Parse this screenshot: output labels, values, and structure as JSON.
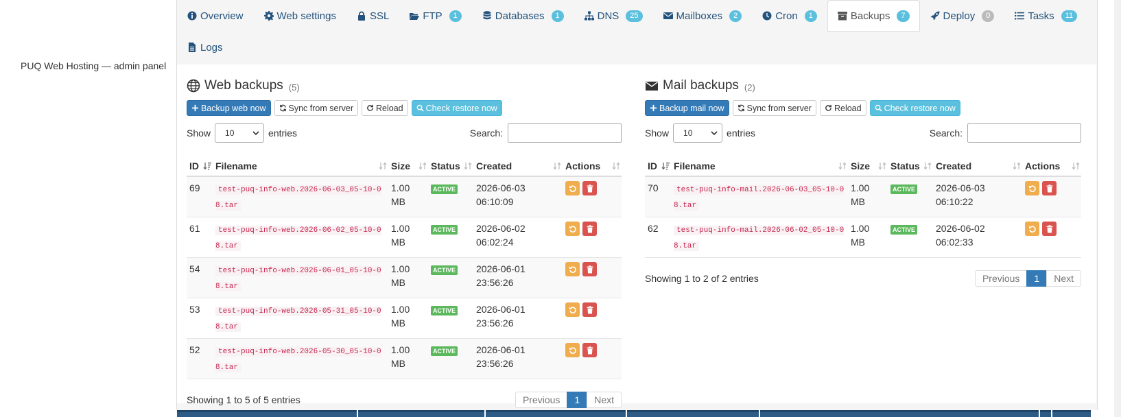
{
  "app": {
    "side_label": "PUQ Web Hosting — admin panel"
  },
  "tabs": [
    {
      "label": "Overview",
      "icon": "info-circle-icon",
      "badge": ""
    },
    {
      "label": "Web settings",
      "icon": "gear-icon",
      "badge": ""
    },
    {
      "label": "SSL",
      "icon": "lock-icon",
      "badge": ""
    },
    {
      "label": "FTP",
      "icon": "folder-open-icon",
      "badge": "1"
    },
    {
      "label": "Databases",
      "icon": "database-icon",
      "badge": "1"
    },
    {
      "label": "DNS",
      "icon": "sitemap-icon",
      "badge": "25"
    },
    {
      "label": "Mailboxes",
      "icon": "envelope-icon",
      "badge": "2"
    },
    {
      "label": "Cron",
      "icon": "clock-icon",
      "badge": "1"
    },
    {
      "label": "Backups",
      "icon": "archive-icon",
      "badge": "7",
      "active": true
    },
    {
      "label": "Deploy",
      "icon": "rocket-icon",
      "badge": "0"
    },
    {
      "label": "Tasks",
      "icon": "list-icon",
      "badge": "11"
    },
    {
      "label": "Logs",
      "icon": "file-icon",
      "badge": ""
    }
  ],
  "web": {
    "title": "Web backups",
    "count": "(5)",
    "buttons": {
      "backup_now": "Backup web now",
      "sync": "Sync from server",
      "reload": "Reload",
      "check_restore": "Check restore now"
    },
    "show_label": "Show",
    "entries_label": "entries",
    "page_length": "10",
    "search_label": "Search:",
    "search_value": "",
    "columns": [
      "ID",
      "Filename",
      "Size",
      "Status",
      "Created",
      "Actions"
    ],
    "rows": [
      {
        "id": "69",
        "filename": "test-puq-info-web.2026-06-03_05-10-08.tar",
        "size": "1.00 MB",
        "status": "ACTIVE",
        "created": "2026-06-03 06:10:09"
      },
      {
        "id": "61",
        "filename": "test-puq-info-web.2026-06-02_05-10-08.tar",
        "size": "1.00 MB",
        "status": "ACTIVE",
        "created": "2026-06-02 06:02:24"
      },
      {
        "id": "54",
        "filename": "test-puq-info-web.2026-06-01_05-10-08.tar",
        "size": "1.00 MB",
        "status": "ACTIVE",
        "created": "2026-06-01 23:56:26"
      },
      {
        "id": "53",
        "filename": "test-puq-info-web.2026-05-31_05-10-08.tar",
        "size": "1.00 MB",
        "status": "ACTIVE",
        "created": "2026-06-01 23:56:26"
      },
      {
        "id": "52",
        "filename": "test-puq-info-web.2026-05-30_05-10-08.tar",
        "size": "1.00 MB",
        "status": "ACTIVE",
        "created": "2026-06-01 23:56:26"
      }
    ],
    "info": "Showing 1 to 5 of 5 entries",
    "pager": {
      "prev": "Previous",
      "page": "1",
      "next": "Next"
    }
  },
  "mail": {
    "title": "Mail backups",
    "count": "(2)",
    "buttons": {
      "backup_now": "Backup mail now",
      "sync": "Sync from server",
      "reload": "Reload",
      "check_restore": "Check restore now"
    },
    "show_label": "Show",
    "entries_label": "entries",
    "page_length": "10",
    "search_label": "Search:",
    "search_value": "",
    "columns": [
      "ID",
      "Filename",
      "Size",
      "Status",
      "Created",
      "Actions"
    ],
    "rows": [
      {
        "id": "70",
        "filename": "test-puq-info-mail.2026-06-03_05-10-08.tar",
        "size": "1.00 MB",
        "status": "ACTIVE",
        "created": "2026-06-03 06:10:22"
      },
      {
        "id": "62",
        "filename": "test-puq-info-mail.2026-06-02_05-10-08.tar",
        "size": "1.00 MB",
        "status": "ACTIVE",
        "created": "2026-06-02 06:02:33"
      }
    ],
    "info": "Showing 1 to 2 of 2 entries",
    "pager": {
      "prev": "Previous",
      "page": "1",
      "next": "Next"
    }
  },
  "colors": {
    "primary": "#337ab7",
    "info": "#5bc0de",
    "success": "#5cb85c",
    "warning": "#f0ad4e",
    "danger": "#d9534f",
    "code": "#c7254e"
  }
}
